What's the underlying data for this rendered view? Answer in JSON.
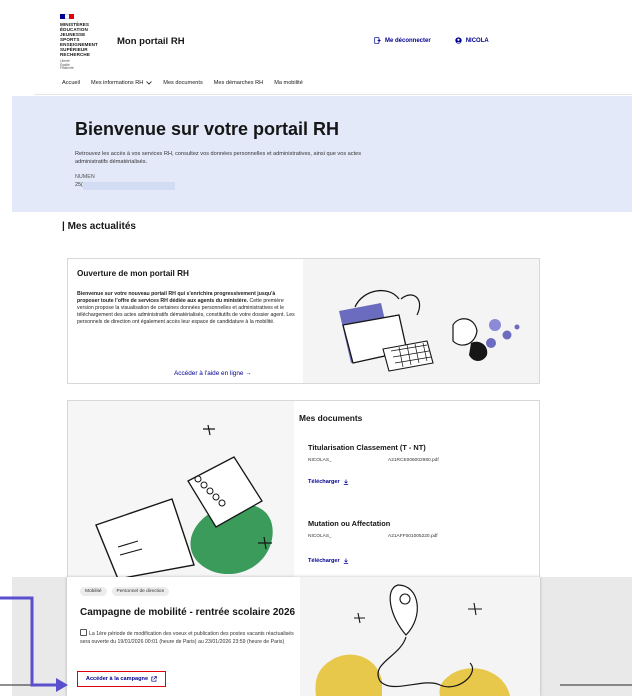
{
  "header": {
    "logo_lines": "Ministères\nÉducation\nJeunesse\nSports\nEnseignement\nSupérieur\nRecherche",
    "logo_motto": "Liberté\nÉgalité\nFraternité",
    "app_title": "Mon portail RH",
    "logout_label": "Me déconnecter",
    "user_label": "NICOLA"
  },
  "nav": {
    "items": [
      {
        "label": "Accueil"
      },
      {
        "label": "Mes informations RH"
      },
      {
        "label": "Mes documents"
      },
      {
        "label": "Mes démarches RH"
      },
      {
        "label": "Ma mobilité"
      }
    ]
  },
  "hero": {
    "title": "Bienvenue sur votre portail RH",
    "text": "Retrouvez les accès à vos services RH, consultez vos données personnelles et administratives, ainsi que vos actes administratifs dématérialisés.",
    "numen_label": "NUMEN",
    "numen_value": "25("
  },
  "news": {
    "section_title": "| Mes actualités",
    "portal_card": {
      "title": "Ouverture de mon portail RH",
      "body_bold": "Bienvenue sur votre nouveau portail RH qui s'enrichira progressivement jusqu'à proposer toute l'offre de services RH dédiée aux agents du ministère.",
      "body_rest": " Cette première version propose la visualisation de certaines données personnelles et administratives et le téléchargement des actes administratifs dématérialisés, constitutifs de votre dossier agent. Les personnels de direction ont également accès leur espace de candidature à la mobilité.",
      "link": "Accéder à l'aide en ligne →"
    },
    "documents_card": {
      "title": "Mes documents",
      "docs": [
        {
          "title": "Titularisation Classement (T - NT)",
          "owner": "NICOLAS_",
          "file": "A21RCE006002980.pdf",
          "download": "Télécharger"
        },
        {
          "title": "Mutation ou Affectation",
          "owner": "NICOLAS_",
          "file": "A21AFF001005220.pdf",
          "download": "Télécharger"
        }
      ]
    },
    "mobility_card": {
      "tags": [
        "Mobilité",
        "Personnel de direction"
      ],
      "title": "Campagne de mobilité - rentrée scolaire 2026",
      "body": "La 1ère période de modification des voeux et publication des postes vacants réactualisés sera ouverte du 19/01/2026 00:01 (heure de Paris) au 23/01/2026 23:59 (heure de Paris)",
      "cta": "Accéder à la campagne"
    }
  },
  "colors": {
    "primary": "#000091",
    "hero_bg": "#e3e9f8",
    "accent_red": "#e1000f",
    "annotation": "#5a4fcf",
    "illus_purple": "#6b6bbf",
    "illus_green": "#3a9b5b",
    "illus_yellow": "#e8c84a"
  }
}
